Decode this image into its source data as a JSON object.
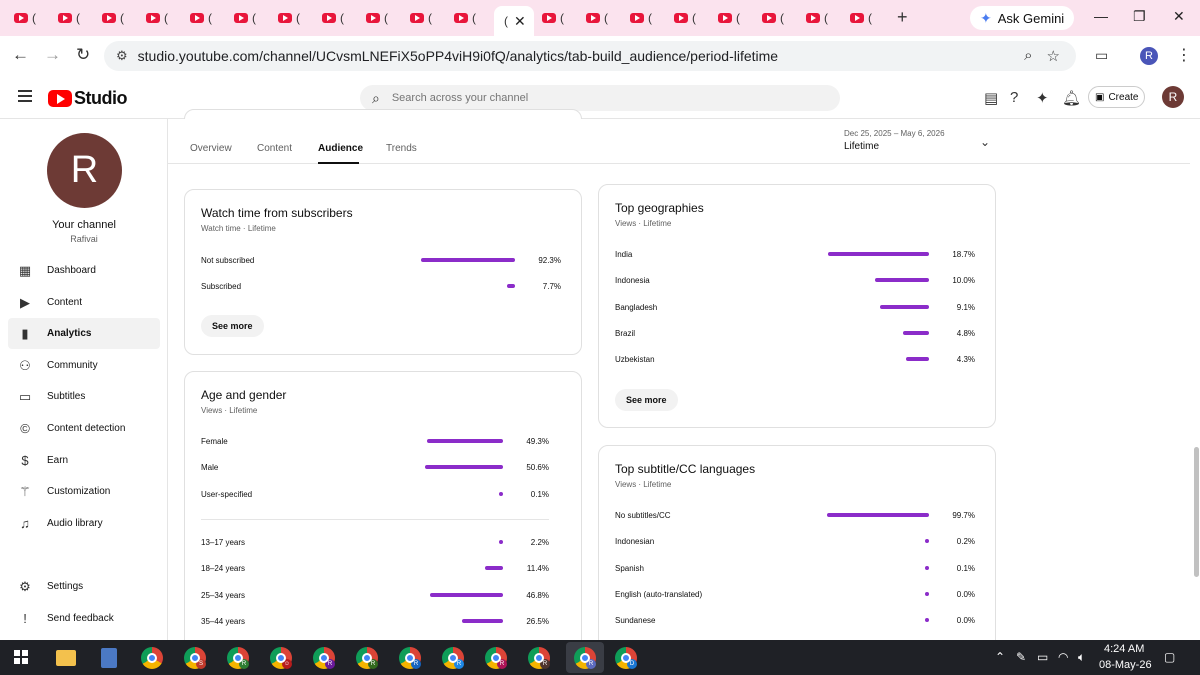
{
  "browser": {
    "tab_paren": "(",
    "active_tab_close": "✕",
    "new_tab": "+",
    "gemini_label": "Ask Gemini",
    "url": "studio.youtube.com/channel/UCvsmLNEFiX5oPP4viH9i0fQ/analytics/tab-build_audience/period-lifetime",
    "profile_initial": "R",
    "minimize": "—",
    "restore": "❐",
    "close": "✕"
  },
  "header": {
    "logo_text": "Studio",
    "search_placeholder": "Search across your channel",
    "create_label": "Create",
    "avatar_initial": "R"
  },
  "sidebar": {
    "avatar_initial": "R",
    "channel_title": "Your channel",
    "channel_name": "Rafivai",
    "items": [
      {
        "label": "Dashboard",
        "icon": "dashboard-icon"
      },
      {
        "label": "Content",
        "icon": "content-icon"
      },
      {
        "label": "Analytics",
        "icon": "analytics-icon"
      },
      {
        "label": "Community",
        "icon": "community-icon"
      },
      {
        "label": "Subtitles",
        "icon": "subtitles-icon"
      },
      {
        "label": "Content detection",
        "icon": "copyright-icon"
      },
      {
        "label": "Earn",
        "icon": "dollar-icon"
      },
      {
        "label": "Customization",
        "icon": "magic-wand-icon"
      },
      {
        "label": "Audio library",
        "icon": "audio-library-icon"
      }
    ],
    "bottom_items": [
      {
        "label": "Settings",
        "icon": "gear-icon"
      },
      {
        "label": "Send feedback",
        "icon": "feedback-icon"
      }
    ]
  },
  "tabs": [
    "Overview",
    "Content",
    "Audience",
    "Trends"
  ],
  "period": {
    "range": "Dec 25, 2025 – May 6, 2026",
    "name": "Lifetime"
  },
  "watch_time": {
    "title": "Watch time from subscribers",
    "subtitle": "Watch time · Lifetime",
    "rows": [
      {
        "label": "Not subscribed",
        "value": "92.3%",
        "fraction": 0.923
      },
      {
        "label": "Subscribed",
        "value": "7.7%",
        "fraction": 0.077
      }
    ],
    "see_more": "See more"
  },
  "age_gender": {
    "title": "Age and gender",
    "subtitle": "Views · Lifetime",
    "gender_rows": [
      {
        "label": "Female",
        "value": "49.3%",
        "fraction": 0.493
      },
      {
        "label": "Male",
        "value": "50.6%",
        "fraction": 0.506
      },
      {
        "label": "User-specified",
        "value": "0.1%",
        "fraction": 0.001
      }
    ],
    "age_rows": [
      {
        "label": "13–17 years",
        "value": "2.2%",
        "fraction": 0.022
      },
      {
        "label": "18–24 years",
        "value": "11.4%",
        "fraction": 0.114
      },
      {
        "label": "25–34 years",
        "value": "46.8%",
        "fraction": 0.468
      },
      {
        "label": "35–44 years",
        "value": "26.5%",
        "fraction": 0.265
      }
    ]
  },
  "geographies": {
    "title": "Top geographies",
    "subtitle": "Views · Lifetime",
    "rows": [
      {
        "label": "India",
        "value": "18.7%",
        "fraction": 0.187
      },
      {
        "label": "Indonesia",
        "value": "10.0%",
        "fraction": 0.1
      },
      {
        "label": "Bangladesh",
        "value": "9.1%",
        "fraction": 0.091
      },
      {
        "label": "Brazil",
        "value": "4.8%",
        "fraction": 0.048
      },
      {
        "label": "Uzbekistan",
        "value": "4.3%",
        "fraction": 0.043
      }
    ],
    "see_more": "See more"
  },
  "subtitles": {
    "title": "Top subtitle/CC languages",
    "subtitle": "Views · Lifetime",
    "rows": [
      {
        "label": "No subtitles/CC",
        "value": "99.7%",
        "fraction": 0.997
      },
      {
        "label": "Indonesian",
        "value": "0.2%",
        "fraction": 0.002
      },
      {
        "label": "Spanish",
        "value": "0.1%",
        "fraction": 0.001
      },
      {
        "label": "English (auto-translated)",
        "value": "0.0%",
        "fraction": 0.0
      },
      {
        "label": "Sundanese",
        "value": "0.0%",
        "fraction": 0.0
      }
    ]
  },
  "taskbar": {
    "time": "4:24 AM",
    "date": "08-May-26"
  },
  "colors": {
    "bar": "#8b2cc9",
    "youtube_red": "#ff0000",
    "avatar": "#6d3a35"
  }
}
